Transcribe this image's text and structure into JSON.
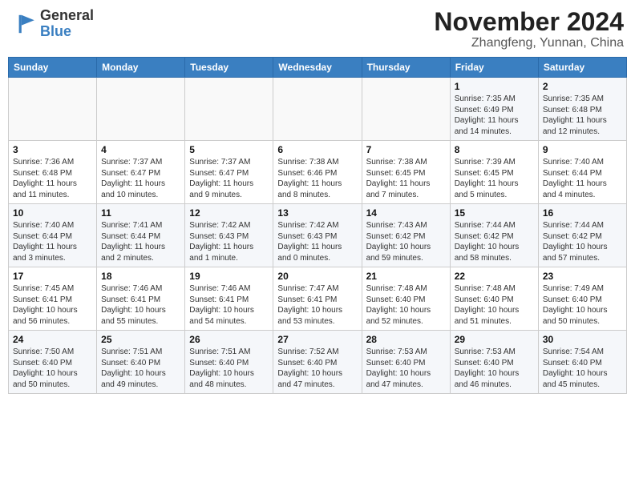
{
  "header": {
    "logo_line1": "General",
    "logo_line2": "Blue",
    "month": "November 2024",
    "location": "Zhangfeng, Yunnan, China"
  },
  "days_of_week": [
    "Sunday",
    "Monday",
    "Tuesday",
    "Wednesday",
    "Thursday",
    "Friday",
    "Saturday"
  ],
  "weeks": [
    [
      {
        "day": "",
        "detail": ""
      },
      {
        "day": "",
        "detail": ""
      },
      {
        "day": "",
        "detail": ""
      },
      {
        "day": "",
        "detail": ""
      },
      {
        "day": "",
        "detail": ""
      },
      {
        "day": "1",
        "detail": "Sunrise: 7:35 AM\nSunset: 6:49 PM\nDaylight: 11 hours and 14 minutes."
      },
      {
        "day": "2",
        "detail": "Sunrise: 7:35 AM\nSunset: 6:48 PM\nDaylight: 11 hours and 12 minutes."
      }
    ],
    [
      {
        "day": "3",
        "detail": "Sunrise: 7:36 AM\nSunset: 6:48 PM\nDaylight: 11 hours and 11 minutes."
      },
      {
        "day": "4",
        "detail": "Sunrise: 7:37 AM\nSunset: 6:47 PM\nDaylight: 11 hours and 10 minutes."
      },
      {
        "day": "5",
        "detail": "Sunrise: 7:37 AM\nSunset: 6:47 PM\nDaylight: 11 hours and 9 minutes."
      },
      {
        "day": "6",
        "detail": "Sunrise: 7:38 AM\nSunset: 6:46 PM\nDaylight: 11 hours and 8 minutes."
      },
      {
        "day": "7",
        "detail": "Sunrise: 7:38 AM\nSunset: 6:45 PM\nDaylight: 11 hours and 7 minutes."
      },
      {
        "day": "8",
        "detail": "Sunrise: 7:39 AM\nSunset: 6:45 PM\nDaylight: 11 hours and 5 minutes."
      },
      {
        "day": "9",
        "detail": "Sunrise: 7:40 AM\nSunset: 6:44 PM\nDaylight: 11 hours and 4 minutes."
      }
    ],
    [
      {
        "day": "10",
        "detail": "Sunrise: 7:40 AM\nSunset: 6:44 PM\nDaylight: 11 hours and 3 minutes."
      },
      {
        "day": "11",
        "detail": "Sunrise: 7:41 AM\nSunset: 6:44 PM\nDaylight: 11 hours and 2 minutes."
      },
      {
        "day": "12",
        "detail": "Sunrise: 7:42 AM\nSunset: 6:43 PM\nDaylight: 11 hours and 1 minute."
      },
      {
        "day": "13",
        "detail": "Sunrise: 7:42 AM\nSunset: 6:43 PM\nDaylight: 11 hours and 0 minutes."
      },
      {
        "day": "14",
        "detail": "Sunrise: 7:43 AM\nSunset: 6:42 PM\nDaylight: 10 hours and 59 minutes."
      },
      {
        "day": "15",
        "detail": "Sunrise: 7:44 AM\nSunset: 6:42 PM\nDaylight: 10 hours and 58 minutes."
      },
      {
        "day": "16",
        "detail": "Sunrise: 7:44 AM\nSunset: 6:42 PM\nDaylight: 10 hours and 57 minutes."
      }
    ],
    [
      {
        "day": "17",
        "detail": "Sunrise: 7:45 AM\nSunset: 6:41 PM\nDaylight: 10 hours and 56 minutes."
      },
      {
        "day": "18",
        "detail": "Sunrise: 7:46 AM\nSunset: 6:41 PM\nDaylight: 10 hours and 55 minutes."
      },
      {
        "day": "19",
        "detail": "Sunrise: 7:46 AM\nSunset: 6:41 PM\nDaylight: 10 hours and 54 minutes."
      },
      {
        "day": "20",
        "detail": "Sunrise: 7:47 AM\nSunset: 6:41 PM\nDaylight: 10 hours and 53 minutes."
      },
      {
        "day": "21",
        "detail": "Sunrise: 7:48 AM\nSunset: 6:40 PM\nDaylight: 10 hours and 52 minutes."
      },
      {
        "day": "22",
        "detail": "Sunrise: 7:48 AM\nSunset: 6:40 PM\nDaylight: 10 hours and 51 minutes."
      },
      {
        "day": "23",
        "detail": "Sunrise: 7:49 AM\nSunset: 6:40 PM\nDaylight: 10 hours and 50 minutes."
      }
    ],
    [
      {
        "day": "24",
        "detail": "Sunrise: 7:50 AM\nSunset: 6:40 PM\nDaylight: 10 hours and 50 minutes."
      },
      {
        "day": "25",
        "detail": "Sunrise: 7:51 AM\nSunset: 6:40 PM\nDaylight: 10 hours and 49 minutes."
      },
      {
        "day": "26",
        "detail": "Sunrise: 7:51 AM\nSunset: 6:40 PM\nDaylight: 10 hours and 48 minutes."
      },
      {
        "day": "27",
        "detail": "Sunrise: 7:52 AM\nSunset: 6:40 PM\nDaylight: 10 hours and 47 minutes."
      },
      {
        "day": "28",
        "detail": "Sunrise: 7:53 AM\nSunset: 6:40 PM\nDaylight: 10 hours and 47 minutes."
      },
      {
        "day": "29",
        "detail": "Sunrise: 7:53 AM\nSunset: 6:40 PM\nDaylight: 10 hours and 46 minutes."
      },
      {
        "day": "30",
        "detail": "Sunrise: 7:54 AM\nSunset: 6:40 PM\nDaylight: 10 hours and 45 minutes."
      }
    ]
  ]
}
